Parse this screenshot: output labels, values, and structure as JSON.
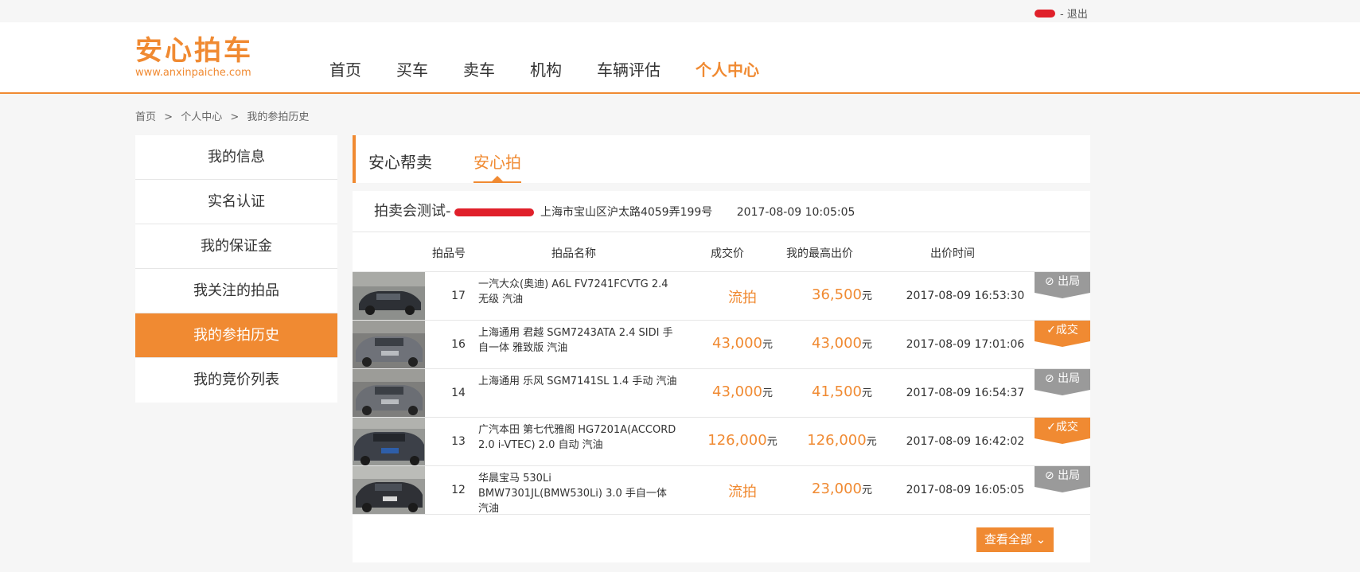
{
  "topbar": {
    "logout": "- 退出"
  },
  "logo": {
    "cn": "安心拍车",
    "url": "www.anxinpaiche.com"
  },
  "nav": [
    "首页",
    "买车",
    "卖车",
    "机构",
    "车辆评估",
    "个人中心"
  ],
  "breadcrumb": [
    "首页",
    ">",
    "个人中心",
    ">",
    "我的参拍历史"
  ],
  "sidebar": [
    "我的信息",
    "实名认证",
    "我的保证金",
    "我关注的拍品",
    "我的参拍历史",
    "我的竞价列表"
  ],
  "tabs": {
    "tab1": "安心帮卖",
    "tab2": "安心拍"
  },
  "auction": {
    "name": "拍卖会测试-",
    "address": "上海市宝山区沪太路4059弄199号",
    "time": "2017-08-09 10:05:05"
  },
  "columns": {
    "lot": "拍品号",
    "name": "拍品名称",
    "deal": "成交价",
    "mybid": "我的最高出价",
    "bidtime": "出价时间"
  },
  "unit": "元",
  "rows": [
    {
      "lot": "17",
      "title": "一汽大众(奥迪) A6L FV7241FCVTG 2.4 无级 汽油",
      "deal": "流拍",
      "deal_unit": "",
      "mybid": "36,500",
      "bidtime": "2017-08-09 16:53:30",
      "status": "出局",
      "status_type": "gray"
    },
    {
      "lot": "16",
      "title": "上海通用 君越 SGM7243ATA 2.4 SIDI 手自一体 雅致版 汽油",
      "deal": "43,000",
      "deal_unit": "元",
      "mybid": "43,000",
      "bidtime": "2017-08-09 17:01:06",
      "status": "成交",
      "status_type": "orange"
    },
    {
      "lot": "14",
      "title": "上海通用 乐风 SGM7141SL 1.4 手动 汽油",
      "deal": "43,000",
      "deal_unit": "元",
      "mybid": "41,500",
      "bidtime": "2017-08-09 16:54:37",
      "status": "出局",
      "status_type": "gray"
    },
    {
      "lot": "13",
      "title": "广汽本田 第七代雅阁 HG7201A(ACCORD 2.0 i-VTEC) 2.0 自动 汽油",
      "deal": "126,000",
      "deal_unit": "元",
      "mybid": "126,000",
      "bidtime": "2017-08-09 16:42:02",
      "status": "成交",
      "status_type": "orange"
    },
    {
      "lot": "12",
      "title": "华晨宝马 530Li BMW7301JL(BMW530Li) 3.0 手自一体 汽油",
      "deal": "流拍",
      "deal_unit": "",
      "mybid": "23,000",
      "bidtime": "2017-08-09 16:05:05",
      "status": "出局",
      "status_type": "gray"
    }
  ],
  "viewall": "查看全部 ⌄",
  "colors": {
    "accent": "#f08a32",
    "gray_status": "#9a9a9a"
  }
}
